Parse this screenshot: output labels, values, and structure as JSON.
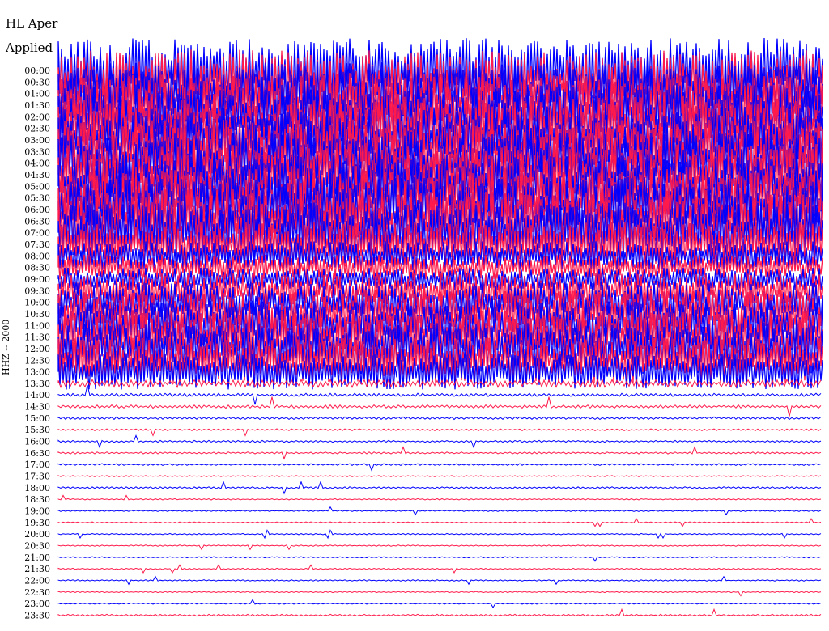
{
  "header": {
    "station": "HL Aper",
    "filter_status": "Applied"
  },
  "channel_label": "HHZ -- 2000",
  "colors": {
    "trace_a": "#0000ff",
    "trace_b": "#ff1a4b",
    "background": "#ffffff",
    "text": "#000000"
  },
  "chart_data": {
    "type": "line",
    "description_kind": "helicorder",
    "row_labels": [
      "00:00",
      "00:30",
      "01:00",
      "01:30",
      "02:00",
      "02:30",
      "03:00",
      "03:30",
      "04:00",
      "04:30",
      "05:00",
      "05:30",
      "06:00",
      "06:30",
      "07:00",
      "07:30",
      "08:00",
      "08:30",
      "09:00",
      "09:30",
      "10:00",
      "10:30",
      "11:00",
      "11:30",
      "12:00",
      "12:30",
      "13:00",
      "13:30",
      "14:00",
      "14:30",
      "15:00",
      "15:30",
      "16:00",
      "16:30",
      "17:00",
      "17:30",
      "18:00",
      "18:30",
      "19:00",
      "19:30",
      "20:00",
      "20:30",
      "21:00",
      "21:30",
      "22:00",
      "22:30",
      "23:00",
      "23:30"
    ],
    "row_colors": [
      "trace_a",
      "trace_b"
    ],
    "amplitude_per_row": [
      1.0,
      1.0,
      1.0,
      1.0,
      1.0,
      1.0,
      1.0,
      1.0,
      1.0,
      1.0,
      1.0,
      1.0,
      1.0,
      1.0,
      0.95,
      0.7,
      0.45,
      0.4,
      0.35,
      0.55,
      0.6,
      0.75,
      0.8,
      0.85,
      0.8,
      0.7,
      0.55,
      0.12,
      0.05,
      0.05,
      0.04,
      0.03,
      0.03,
      0.03,
      0.03,
      0.02,
      0.03,
      0.02,
      0.02,
      0.02,
      0.02,
      0.02,
      0.02,
      0.02,
      0.02,
      0.02,
      0.02,
      0.03
    ],
    "legend": "none",
    "grid": false
  }
}
